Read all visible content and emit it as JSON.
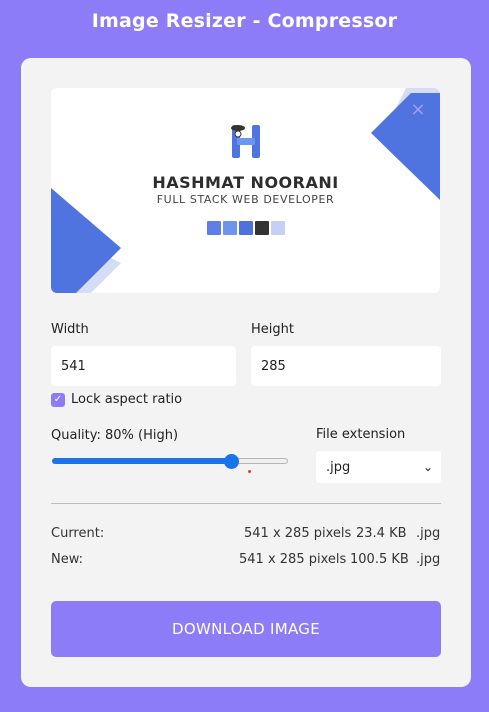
{
  "app": {
    "title": "Image Resizer - Compressor"
  },
  "preview": {
    "brand_name": "HASHMAT NOORANI",
    "brand_subtitle": "FULL STACK WEB DEVELOPER",
    "close_glyph": "×",
    "swatch_colors": [
      "#5f7fe8",
      "#6c96ee",
      "#4e72db",
      "#333333",
      "#c6d0f6"
    ],
    "logo_letter": "H"
  },
  "dimensions": {
    "width_label": "Width",
    "width_value": "541",
    "height_label": "Height",
    "height_value": "285",
    "lock_label": "Lock aspect ratio",
    "lock_checked": true
  },
  "quality": {
    "label": "Quality: 80% (High)",
    "value": 80
  },
  "extension": {
    "label": "File extension",
    "selected": ".jpg"
  },
  "info": {
    "current_label": "Current:",
    "current_size": "541 x 285 pixels",
    "current_kb": "23.4 KB",
    "current_ext": ".jpg",
    "new_label": "New:",
    "new_size": "541 x 285 pixels",
    "new_kb": "100.5 KB",
    "new_ext": ".jpg"
  },
  "download": {
    "label": "DOWNLOAD IMAGE"
  },
  "colors": {
    "background": "#8c7cf8",
    "accent_blue": "#1a73e8",
    "card": "#f3f3f3"
  }
}
